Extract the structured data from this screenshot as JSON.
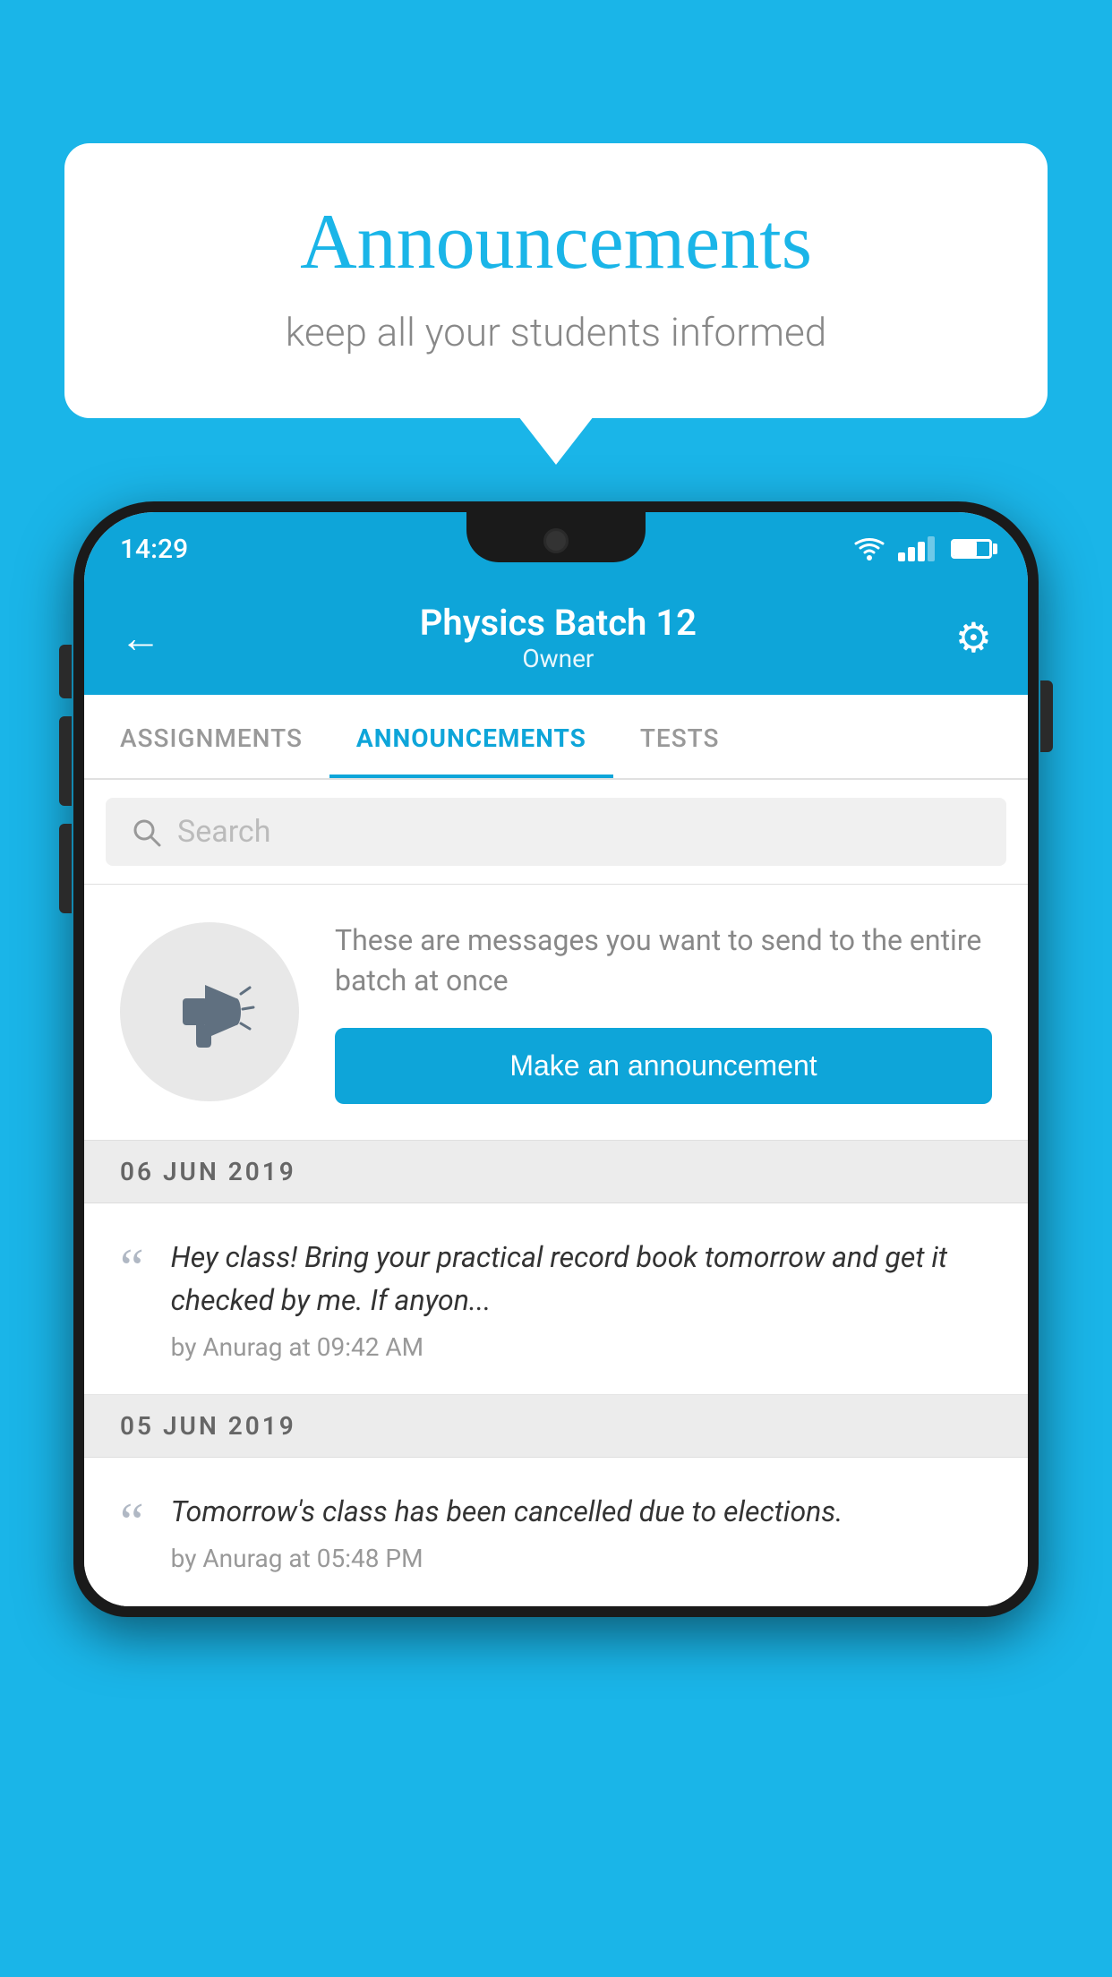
{
  "background": {
    "color": "#1ab5e8"
  },
  "speechBubble": {
    "title": "Announcements",
    "subtitle": "keep all your students informed"
  },
  "phone": {
    "statusBar": {
      "time": "14:29",
      "icons": [
        "wifi",
        "signal",
        "battery"
      ]
    },
    "header": {
      "title": "Physics Batch 12",
      "subtitle": "Owner",
      "backLabel": "←",
      "gearLabel": "⚙"
    },
    "tabs": [
      {
        "label": "ASSIGNMENTS",
        "active": false
      },
      {
        "label": "ANNOUNCEMENTS",
        "active": true
      },
      {
        "label": "TESTS",
        "active": false
      }
    ],
    "searchBar": {
      "placeholder": "Search"
    },
    "emptyState": {
      "description": "These are messages you want to send to the entire batch at once",
      "buttonLabel": "Make an announcement"
    },
    "announcements": [
      {
        "date": "06  JUN  2019",
        "text": "Hey class! Bring your practical record book tomorrow and get it checked by me. If anyon...",
        "meta": "by Anurag at 09:42 AM"
      },
      {
        "date": "05  JUN  2019",
        "text": "Tomorrow's class has been cancelled due to elections.",
        "meta": "by Anurag at 05:48 PM"
      }
    ]
  }
}
